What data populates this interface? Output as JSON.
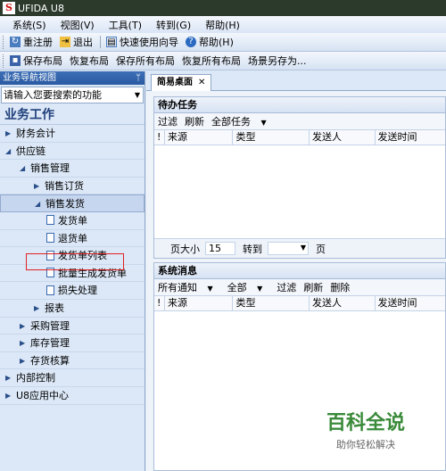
{
  "window": {
    "title": "UFIDA U8",
    "logo": "S"
  },
  "menu": [
    "系统(S)",
    "视图(V)",
    "工具(T)",
    "转到(G)",
    "帮助(H)"
  ],
  "toolbar1": [
    {
      "label": "重注册",
      "icon": "re-register-icon"
    },
    {
      "label": "退出",
      "icon": "exit-icon"
    },
    {
      "label": "快速使用向导",
      "icon": "wizard-icon"
    },
    {
      "label": "帮助(H)",
      "icon": "help-icon"
    }
  ],
  "toolbar2": [
    {
      "label": "保存布局",
      "icon": "save-icon"
    },
    {
      "label": "恢复布局"
    },
    {
      "label": "保存所有布局"
    },
    {
      "label": "恢复所有布局"
    },
    {
      "label": "场景另存为..."
    }
  ],
  "nav": {
    "header": "业务导航视图",
    "pin": "ᛘ",
    "search_placeholder": "请输入您要搜索的功能",
    "section_title": "业务工作",
    "items": [
      {
        "label": "财务会计",
        "expanded": false
      },
      {
        "label": "供应链",
        "expanded": true
      },
      {
        "label": "销售管理",
        "expanded": true
      },
      {
        "label": "销售订货",
        "expanded": false
      },
      {
        "label": "销售发货",
        "expanded": true
      },
      {
        "label": "发货单"
      },
      {
        "label": "退货单"
      },
      {
        "label": "发货单列表"
      },
      {
        "label": "批量生成发货单"
      },
      {
        "label": "损失处理"
      },
      {
        "label": "报表",
        "expanded": false
      },
      {
        "label": "采购管理",
        "expanded": false
      },
      {
        "label": "库存管理",
        "expanded": false
      },
      {
        "label": "存货核算",
        "expanded": false
      },
      {
        "label": "内部控制",
        "expanded": false
      },
      {
        "label": "U8应用中心",
        "expanded": false
      }
    ]
  },
  "tabs": [
    {
      "label": "简易桌面",
      "close": "✕"
    }
  ],
  "todo": {
    "title": "待办任务",
    "actions": [
      "过滤",
      "刷新",
      "全部任务"
    ],
    "columns": [
      "!",
      "来源",
      "类型",
      "发送人",
      "发送时间"
    ],
    "pager": {
      "page_size_label": "页大小",
      "page_size": "15",
      "goto_label": "转到",
      "page_label": "页"
    }
  },
  "messages": {
    "title": "系统消息",
    "actions": [
      "所有通知",
      "全部",
      "过滤",
      "刷新",
      "删除"
    ],
    "columns": [
      "!",
      "来源",
      "类型",
      "发送人",
      "发送时间"
    ]
  },
  "watermark": {
    "line1": "百科全说",
    "line2": "助你轻松解决"
  }
}
